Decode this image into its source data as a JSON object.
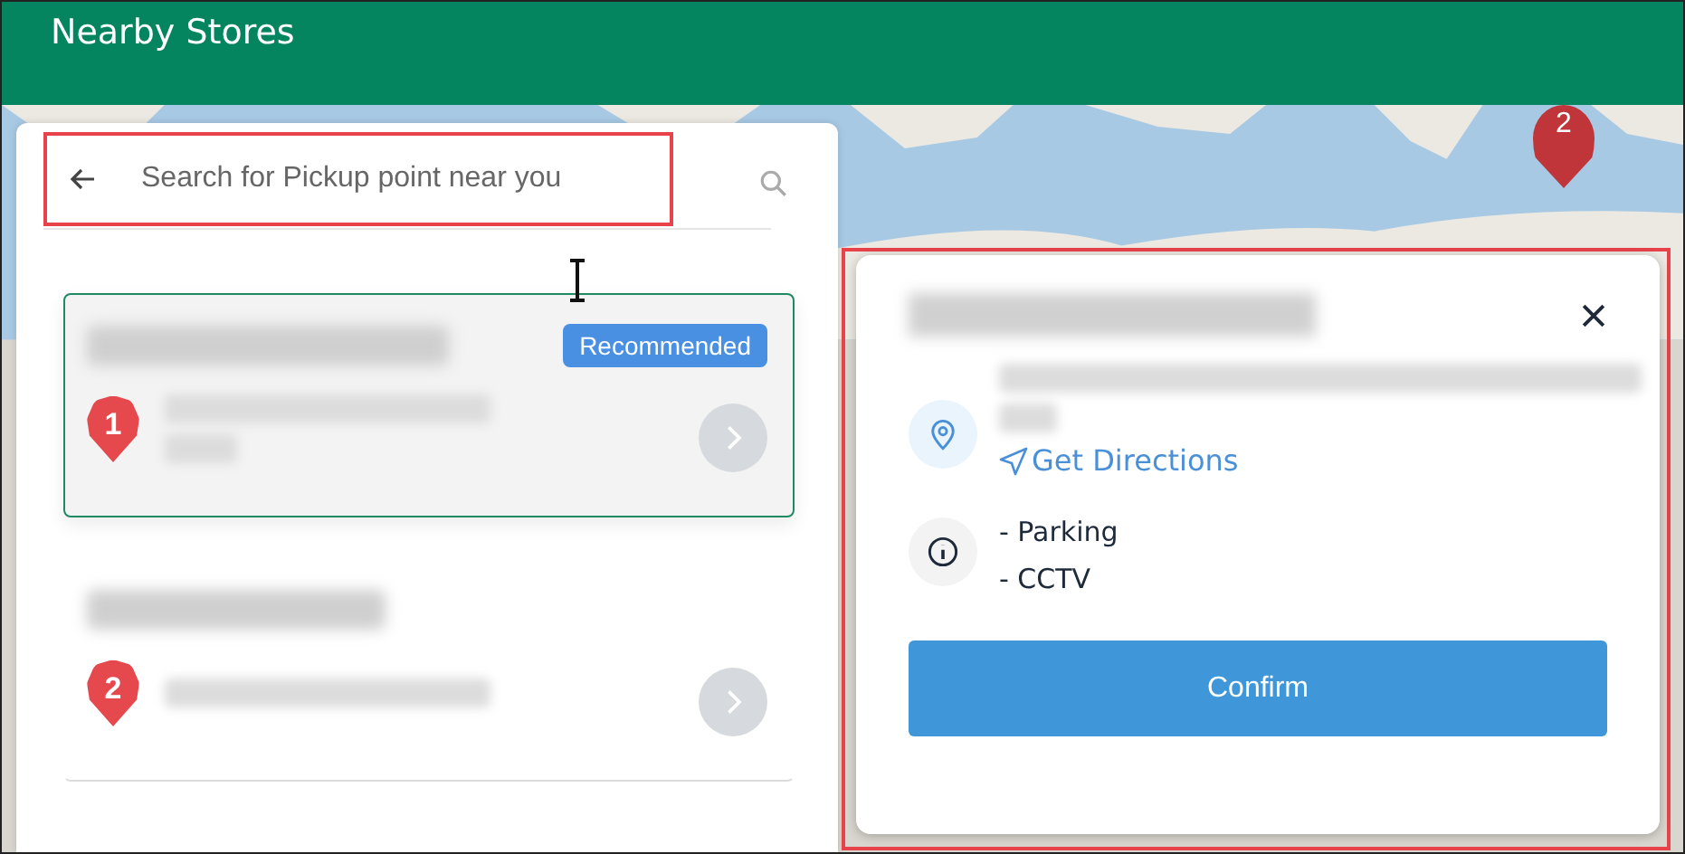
{
  "header": {
    "title": "Nearby Stores"
  },
  "search": {
    "placeholder": "Search for Pickup point near you",
    "highlighted": true
  },
  "stores": [
    {
      "number": "1",
      "badge": "Recommended",
      "selected": true
    },
    {
      "number": "2",
      "selected": false
    }
  ],
  "map_marker": {
    "number": "2"
  },
  "details": {
    "highlighted": true,
    "directions": "Get Directions",
    "features": [
      "- Parking",
      "- CCTV"
    ],
    "confirm": "Confirm"
  }
}
